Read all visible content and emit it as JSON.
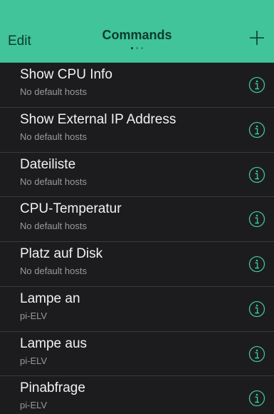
{
  "colors": {
    "header_bg": "#41c49a",
    "header_text": "#0d3a2d",
    "list_bg": "#1c1c1e",
    "title_text": "#f2f2f2",
    "subtitle_text": "#9a9a9a",
    "info_icon": "#41c49a"
  },
  "header": {
    "edit_label": "Edit",
    "title": "Commands",
    "add_icon": "plus-icon",
    "page_dots": {
      "count": 3,
      "active_index": 0
    }
  },
  "commands": [
    {
      "title": "Show CPU Info",
      "hosts": "No default hosts",
      "icon": "info-circle-icon"
    },
    {
      "title": "Show External IP Address",
      "hosts": "No default hosts",
      "icon": "info-circle-icon"
    },
    {
      "title": "Dateiliste",
      "hosts": "No default hosts",
      "icon": "info-circle-icon"
    },
    {
      "title": "CPU-Temperatur",
      "hosts": "No default hosts",
      "icon": "info-circle-icon"
    },
    {
      "title": "Platz auf Disk",
      "hosts": "No default hosts",
      "icon": "info-circle-icon"
    },
    {
      "title": "Lampe an",
      "hosts": "pi-ELV",
      "icon": "info-circle-icon"
    },
    {
      "title": "Lampe aus",
      "hosts": "pi-ELV",
      "icon": "info-circle-icon"
    },
    {
      "title": "Pinabfrage",
      "hosts": "pi-ELV",
      "icon": "info-circle-icon"
    }
  ]
}
